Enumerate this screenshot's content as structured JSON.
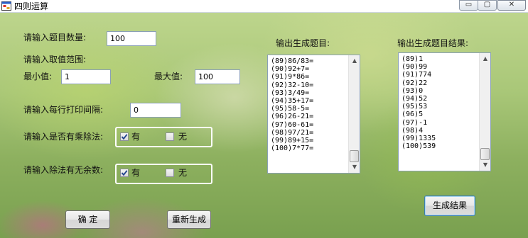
{
  "window": {
    "title": "四则运算",
    "controls": {
      "minimize": "▭",
      "maximize": "▢",
      "close": "✕"
    }
  },
  "form": {
    "count_label": "请输入题目数量:",
    "count_value": "100",
    "range_label": "请输入取值范围:",
    "min_label": "最小值:",
    "min_value": "1",
    "max_label": "最大值:",
    "max_value": "100",
    "interval_label": "请输入每行打印间隔:",
    "interval_value": "0",
    "muldiv_label": "请输入是否有乘除法:",
    "muldiv_yes_label": "有",
    "muldiv_yes_checked": true,
    "muldiv_no_label": "无",
    "muldiv_no_checked": false,
    "remainder_label": "请输入除法有无余数:",
    "remainder_yes_label": "有",
    "remainder_yes_checked": true,
    "remainder_no_label": "无",
    "remainder_no_checked": false
  },
  "questions": {
    "label": "输出生成题目:",
    "items": [
      "(89)86/83=",
      "(90)92+7=",
      "(91)9*86=",
      "(92)32-10=",
      "(93)3/49=",
      "(94)35+17=",
      "(95)58-5=",
      "(96)26-21=",
      "(97)60-61=",
      "(98)97/21=",
      "(99)89+15=",
      "(100)7*77="
    ]
  },
  "results": {
    "label": "输出生成题目结果:",
    "items": [
      "(89)1",
      "(90)99",
      "(91)774",
      "(92)22",
      "(93)0",
      "(94)52",
      "(95)53",
      "(96)5",
      "(97)-1",
      "(98)4",
      "(99)1335",
      "(100)539"
    ]
  },
  "buttons": {
    "confirm": "确  定",
    "regenerate": "重新生成",
    "generate_results": "生成结果"
  },
  "colors": {
    "title_bg": "#ffffff",
    "group_border": "#ffffff",
    "checkmark": "#1c3f8c",
    "focus_border": "#3c7fb1"
  }
}
